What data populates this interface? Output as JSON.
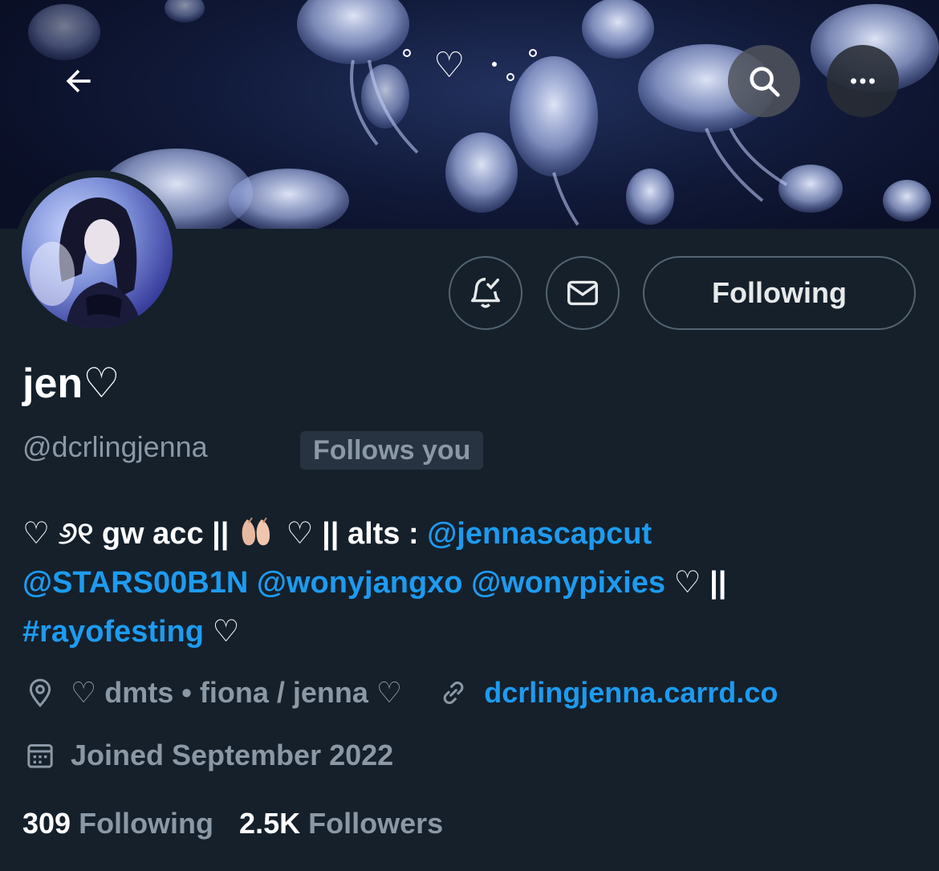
{
  "header": {
    "back_icon": "arrow-left-icon",
    "search_icon": "search-icon",
    "more_icon": "more-horizontal-icon",
    "banner_text": "♡"
  },
  "profile": {
    "display_name": "jen♡",
    "handle": "@dcrlingjenna",
    "follows_you": "Follows you"
  },
  "actions": {
    "notify_icon": "bell-check-icon",
    "message_icon": "envelope-icon",
    "following_label": "Following"
  },
  "bio": {
    "part1": "♡ ୬୧ gw acc || ",
    "part2": " ♡ || alts : ",
    "alt1": "@jennascapcut",
    "alt2": "@STARS00B1N",
    "alt3": "@wonyjangxo",
    "alt4": "@wonypixies",
    "part3": " ♡ ||",
    "hashtag": "#rayofesting",
    "part4": " ♡"
  },
  "meta": {
    "location": "♡ dmts • fiona / jenna ♡",
    "website": "dcrlingjenna.carrd.co",
    "joined": "Joined September 2022"
  },
  "stats": {
    "following_count": "309",
    "following_label": "Following",
    "followers_count": "2.5K",
    "followers_label": "Followers"
  },
  "colors": {
    "background": "#15202b",
    "accent": "#1d9bf0",
    "secondary_text": "#8b98a5"
  }
}
